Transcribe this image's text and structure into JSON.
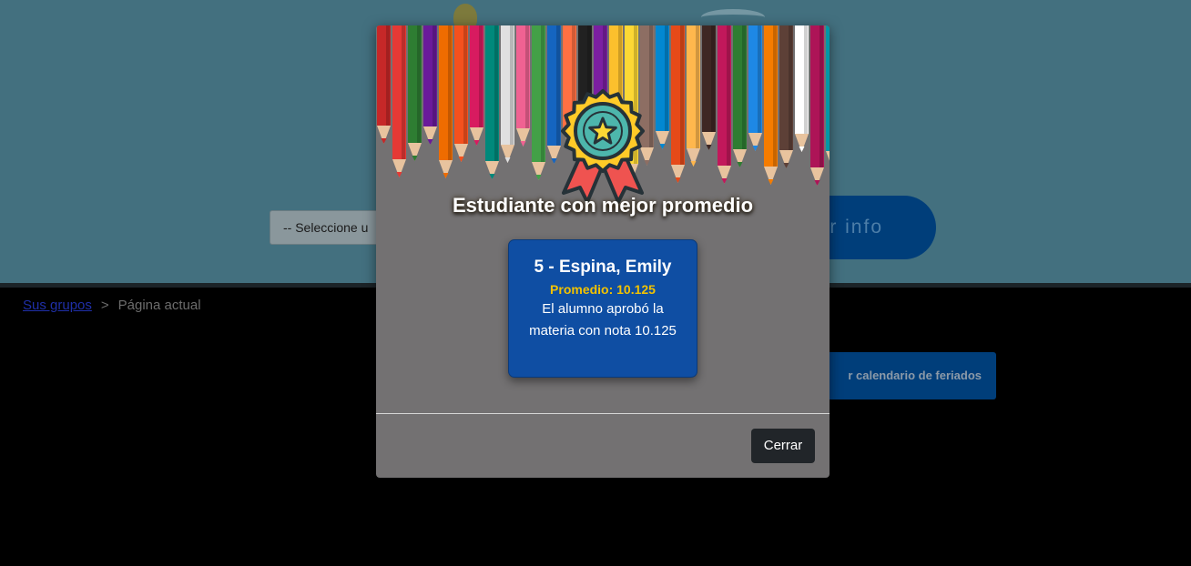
{
  "background": {
    "select_placeholder": "-- Seleccione u",
    "info_button_label": "r info",
    "calendar_button_label": "r calendario de feriados"
  },
  "breadcrumb": {
    "link_label": "Sus grupos",
    "separator": ">",
    "current_label": "Página actual"
  },
  "modal": {
    "title": "Estudiante con mejor promedio",
    "student": {
      "name": "5 - Espina, Emily",
      "average": "Promedio: 10.125",
      "note": "El alumno aprobó la materia con nota 10.125"
    },
    "close_label": "Cerrar",
    "icon": "award-ribbon-star-icon"
  },
  "colors": {
    "hero": "#43707f",
    "modal_bg": "#737172",
    "card": "#0f4ea3",
    "accent_yellow": "#f2c200",
    "dark_button": "#212529"
  }
}
